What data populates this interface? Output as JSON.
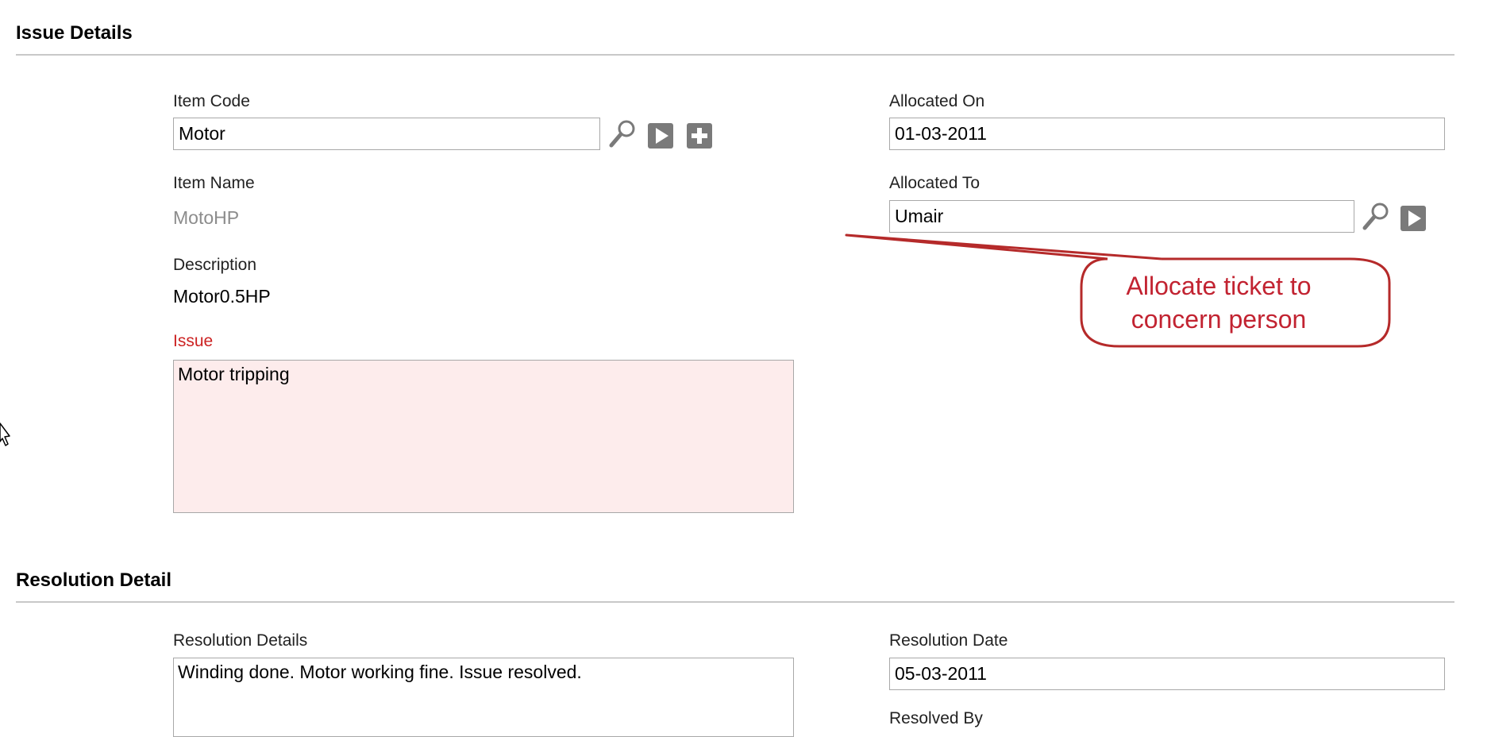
{
  "sections": {
    "issue_details": {
      "title": "Issue Details",
      "item_code": {
        "label": "Item Code",
        "value": "Motor"
      },
      "item_name": {
        "label": "Item Name",
        "value": "MotoHP"
      },
      "description": {
        "label": "Description",
        "value": "Motor0.5HP"
      },
      "issue": {
        "label": "Issue",
        "value": "Motor tripping"
      },
      "allocated_on": {
        "label": "Allocated On",
        "value": "01-03-2011"
      },
      "allocated_to": {
        "label": "Allocated To",
        "value": "Umair"
      }
    },
    "resolution_detail": {
      "title": "Resolution Detail",
      "resolution_details": {
        "label": "Resolution Details",
        "value": "Winding done. Motor working fine. Issue resolved."
      },
      "resolution_date": {
        "label": "Resolution Date",
        "value": "05-03-2011"
      },
      "resolved_by": {
        "label": "Resolved By"
      }
    }
  },
  "callout": {
    "line1": "Allocate ticket to",
    "line2": "concern person"
  },
  "icons": {
    "item_code": [
      "search-icon",
      "open-link-icon",
      "add-icon"
    ],
    "allocated_to": [
      "search-icon",
      "open-link-icon"
    ]
  },
  "colors": {
    "required_label": "#cc2222",
    "issue_background": "#fdecec",
    "callout_text": "#c22331",
    "callout_border": "#b52a2a",
    "icon_gray": "#7a7a7a"
  }
}
